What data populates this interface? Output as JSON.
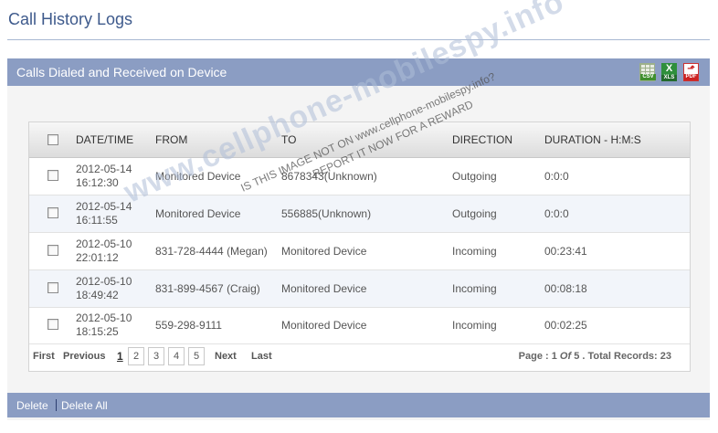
{
  "page_title": "Call History Logs",
  "panel": {
    "title": "Calls Dialed and Received on Device",
    "exports": [
      {
        "icon": "csv-icon",
        "label": "CSV"
      },
      {
        "icon": "xls-icon",
        "label": "XLS"
      },
      {
        "icon": "pdf-icon",
        "label": "PDF"
      }
    ]
  },
  "table": {
    "headers": {
      "datetime": "DATE/TIME",
      "from": "FROM",
      "to": "TO",
      "direction": "DIRECTION",
      "duration": "DURATION - H:M:S"
    },
    "rows": [
      {
        "date": "2012-05-14",
        "time": "16:12:30",
        "from": "Monitored Device",
        "to": "8678343(Unknown)",
        "direction": "Outgoing",
        "duration": "0:0:0"
      },
      {
        "date": "2012-05-14",
        "time": "16:11:55",
        "from": "Monitored Device",
        "to": "556885(Unknown)",
        "direction": "Outgoing",
        "duration": "0:0:0"
      },
      {
        "date": "2012-05-10",
        "time": "22:01:12",
        "from": "831-728-4444 (Megan)",
        "to": "Monitored Device",
        "direction": "Incoming",
        "duration": "00:23:41"
      },
      {
        "date": "2012-05-10",
        "time": "18:49:42",
        "from": "831-899-4567 (Craig)",
        "to": "Monitored Device",
        "direction": "Incoming",
        "duration": "00:08:18"
      },
      {
        "date": "2012-05-10",
        "time": "18:15:25",
        "from": "559-298-9111",
        "to": "Monitored Device",
        "direction": "Incoming",
        "duration": "00:02:25"
      }
    ]
  },
  "pager": {
    "first": "First",
    "previous": "Previous",
    "current": "1",
    "pages": [
      "2",
      "3",
      "4",
      "5"
    ],
    "next": "Next",
    "last": "Last",
    "info_prefix": "Page : 1",
    "info_of": "Of",
    "info_suffix": "5 . Total Records: 23"
  },
  "footer": {
    "delete": "Delete",
    "delete_all": "Delete All"
  },
  "watermark": {
    "main": "www.cellphone-mobilespy.info",
    "line1": "IS THIS IMAGE NOT ON www.cellphone-mobilespy.info?",
    "line2": "REPORT IT NOW FOR A REWARD"
  },
  "colors": {
    "title": "#3e5a8c",
    "header_bar": "#8b9dc3",
    "alt_row": "#f2f5fa"
  }
}
